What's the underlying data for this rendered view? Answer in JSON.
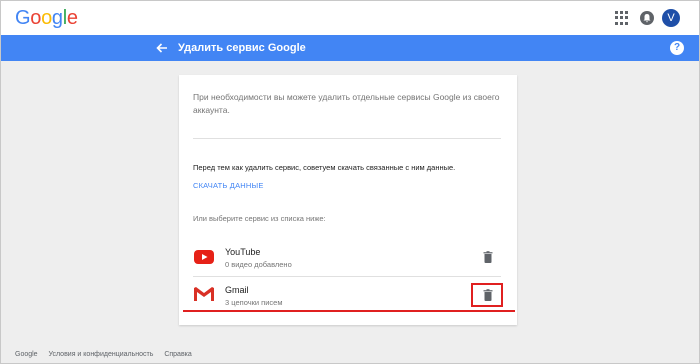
{
  "header": {
    "logo": {
      "letters": [
        "G",
        "o",
        "o",
        "g",
        "l",
        "e"
      ],
      "colors": [
        "#4285f4",
        "#ea4335",
        "#fbbc05",
        "#4285f4",
        "#34a853",
        "#ea4335"
      ]
    },
    "avatar_letter": "V",
    "icons": {
      "apps": "apps-grid-icon",
      "notifications": "bell-icon"
    }
  },
  "bluebar": {
    "title": "Удалить сервис Google",
    "color": "#4285f4",
    "help_label": "?"
  },
  "card": {
    "intro": "При необходимости вы можете удалить отдельные сервисы Google из своего аккаунта.",
    "note": "Перед тем как удалить сервис, советуем скачать связанные с ним данные.",
    "download_link": "СКАЧАТЬ ДАННЫЕ",
    "choose_label": "Или выберите сервис из списка ниже:",
    "services": [
      {
        "name": "YouTube",
        "detail": "0 видео добавлено",
        "icon": "youtube-icon"
      },
      {
        "name": "Gmail",
        "detail": "3 цепочки писем",
        "icon": "gmail-icon"
      }
    ]
  },
  "annotation": {
    "highlight_color": "#e02020"
  },
  "footer": {
    "links": [
      "Google",
      "Условия и конфиденциальность",
      "Справка"
    ]
  }
}
